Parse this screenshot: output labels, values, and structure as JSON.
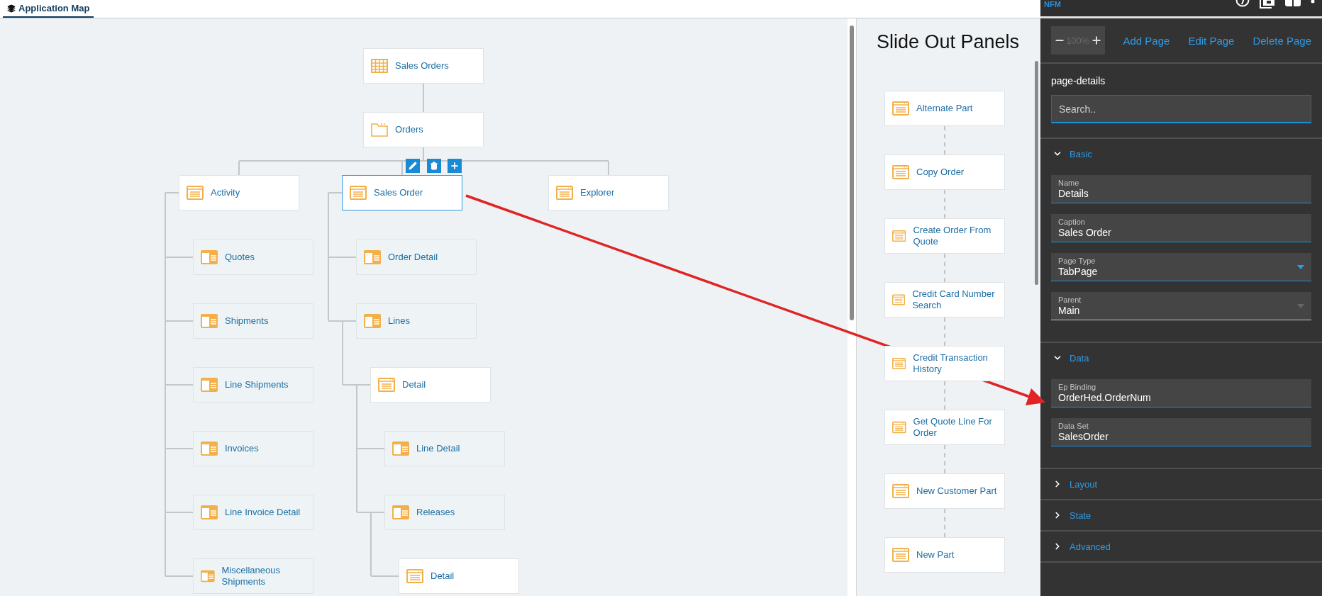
{
  "tabs": [
    {
      "label": "Application Map",
      "selected": true
    }
  ],
  "map": {
    "root": {
      "label": "Sales Orders",
      "kind": "grid",
      "selected": false,
      "children": [
        {
          "label": "Orders",
          "kind": "folder",
          "selected": false,
          "children": [
            {
              "label": "Activity",
              "kind": "page",
              "selected": false,
              "children": [
                {
                  "label": "Quotes",
                  "kind": "split",
                  "selected": false
                },
                {
                  "label": "Shipments",
                  "kind": "split",
                  "selected": false
                },
                {
                  "label": "Line Shipments",
                  "kind": "split",
                  "selected": false
                },
                {
                  "label": "Invoices",
                  "kind": "split",
                  "selected": false
                },
                {
                  "label": "Line Invoice Detail",
                  "kind": "split",
                  "selected": false
                },
                {
                  "label": "Miscellaneous Shipments",
                  "kind": "split",
                  "selected": false
                }
              ]
            },
            {
              "label": "Sales Order",
              "kind": "page",
              "selected": true,
              "children": [
                {
                  "label": "Order Detail",
                  "kind": "split",
                  "selected": false
                },
                {
                  "label": "Lines",
                  "kind": "split",
                  "selected": false,
                  "children": [
                    {
                      "label": "Detail",
                      "kind": "page",
                      "selected": false,
                      "children": [
                        {
                          "label": "Line Detail",
                          "kind": "split",
                          "selected": false
                        },
                        {
                          "label": "Releases",
                          "kind": "split",
                          "selected": false,
                          "children": [
                            {
                              "label": "Detail",
                              "kind": "page",
                              "selected": false
                            }
                          ]
                        }
                      ]
                    }
                  ]
                }
              ]
            },
            {
              "label": "Explorer",
              "kind": "page",
              "selected": false
            }
          ]
        }
      ]
    }
  },
  "slide_out": {
    "title": "Slide Out Panels",
    "panels": [
      {
        "label": "Alternate Part",
        "kind": "page"
      },
      {
        "label": "Copy Order",
        "kind": "page"
      },
      {
        "label": "Create Order From Quote",
        "kind": "page"
      },
      {
        "label": "Credit Card Number Search",
        "kind": "page"
      },
      {
        "label": "Credit Transaction History",
        "kind": "page"
      },
      {
        "label": "Get Quote Line For Order",
        "kind": "page"
      },
      {
        "label": "New Customer Part",
        "kind": "page"
      },
      {
        "label": "New Part",
        "kind": "page"
      }
    ]
  },
  "panel": {
    "brand": "NFM",
    "zoom": "100%",
    "actions": [
      "Add Page",
      "Edit Page",
      "Delete Page"
    ],
    "heading": "page-details",
    "search": {
      "placeholder": "Search.."
    },
    "sections": [
      {
        "title": "Basic",
        "expanded": true,
        "fields": [
          {
            "label": "Name",
            "value": "Details",
            "kind": "text",
            "disabled": false
          },
          {
            "label": "Caption",
            "value": "Sales Order",
            "kind": "text",
            "disabled": false
          },
          {
            "label": "Page Type",
            "value": "TabPage",
            "kind": "select",
            "disabled": false
          },
          {
            "label": "Parent",
            "value": "Main",
            "kind": "select",
            "disabled": true
          }
        ]
      },
      {
        "title": "Data",
        "expanded": true,
        "fields": [
          {
            "label": "Ep Binding",
            "value": "OrderHed.OrderNum",
            "kind": "text",
            "disabled": false
          },
          {
            "label": "Data Set",
            "value": "SalesOrder",
            "kind": "text",
            "disabled": false
          }
        ]
      },
      {
        "title": "Layout",
        "expanded": false
      },
      {
        "title": "State",
        "expanded": false
      },
      {
        "title": "Advanced",
        "expanded": false
      }
    ]
  }
}
